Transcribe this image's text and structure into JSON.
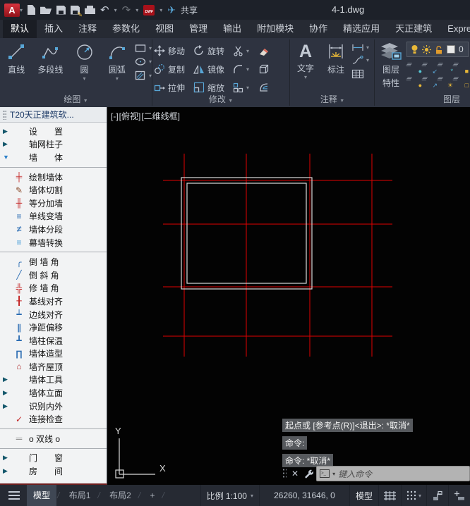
{
  "titlebar": {
    "app_initial": "A",
    "doc_title": "4-1.dwg",
    "dwf_label": "DWF",
    "share_label": "共享"
  },
  "ribbon_tabs": [
    {
      "label": "默认",
      "cls": "active"
    },
    {
      "label": "插入"
    },
    {
      "label": "注释"
    },
    {
      "label": "参数化"
    },
    {
      "label": "视图"
    },
    {
      "label": "管理"
    },
    {
      "label": "输出"
    },
    {
      "label": "附加模块"
    },
    {
      "label": "协作"
    },
    {
      "label": "精选应用"
    },
    {
      "label": "天正建筑"
    },
    {
      "label": "Express Tools"
    }
  ],
  "ribbon": {
    "draw": {
      "label": "绘图",
      "line": "直线",
      "polyline": "多段线",
      "circle": "圆",
      "arc": "圆弧"
    },
    "modify": {
      "label": "修改",
      "move": "移动",
      "rotate": "旋转",
      "copy": "复制",
      "mirror": "镜像",
      "stretch": "拉伸",
      "scale": "缩放"
    },
    "annotate": {
      "label": "注释",
      "text": "文字",
      "dimension": "标注"
    },
    "layers": {
      "label": "图层",
      "properties_line1": "图层",
      "properties_line2": "特性",
      "current_layer": "0"
    }
  },
  "layer_tools": [
    {
      "e": "●",
      "c": "#57c7d4"
    },
    {
      "e": "↙",
      "c": "#58a6d6"
    },
    {
      "e": "*",
      "c": "#57c7d4"
    },
    {
      "e": "■",
      "c": "#e8b838"
    },
    {
      "e": "●",
      "c": "#e8b838"
    },
    {
      "e": "↗",
      "c": "#58a6d6"
    },
    {
      "e": "☀",
      "c": "#e8b838"
    },
    {
      "e": "□",
      "c": "#e8b838"
    }
  ],
  "palette": {
    "title": "T20天正建筑软...",
    "items": [
      {
        "arrow": "▶",
        "ac": "#14576b",
        "label": "设　　置"
      },
      {
        "arrow": "▶",
        "ac": "#14576b",
        "label": "轴网柱子"
      },
      {
        "arrow": "▼",
        "ac": "#2f81c9",
        "label": "墙　　体"
      },
      {
        "cls": "sep"
      },
      {
        "glyph": "╪",
        "gc": "#c32222",
        "label": "绘制墙体"
      },
      {
        "glyph": "✎",
        "gc": "#8a4a2a",
        "label": "墙体切割"
      },
      {
        "glyph": "╫",
        "gc": "#c32222",
        "label": "等分加墙"
      },
      {
        "glyph": "≡",
        "gc": "#2f6fb4",
        "label": "单线变墙"
      },
      {
        "glyph": "≠",
        "gc": "#2f6fb4",
        "label": "墙体分段"
      },
      {
        "glyph": "≡",
        "gc": "#4a9fd8",
        "label": "幕墙转换"
      },
      {
        "cls": "sep"
      },
      {
        "glyph": "╭",
        "gc": "#2f6fb4",
        "label": "倒 墙 角"
      },
      {
        "glyph": "╱",
        "gc": "#2f6fb4",
        "label": "倒 斜 角"
      },
      {
        "glyph": "╬",
        "gc": "#c32222",
        "label": "修 墙 角"
      },
      {
        "glyph": "╂",
        "gc": "#c32222",
        "label": "基线对齐"
      },
      {
        "glyph": "┷",
        "gc": "#2f6fb4",
        "label": "边线对齐"
      },
      {
        "glyph": "∥",
        "gc": "#2f6fb4",
        "label": "净距偏移"
      },
      {
        "glyph": "┻",
        "gc": "#2f6fb4",
        "label": "墙柱保温"
      },
      {
        "glyph": "∏",
        "gc": "#2f6fb4",
        "label": "墙体造型"
      },
      {
        "glyph": "⌂",
        "gc": "#b03030",
        "label": "墙齐屋顶"
      },
      {
        "arrow": "▶",
        "ac": "#14576b",
        "label": "墙体工具"
      },
      {
        "arrow": "▶",
        "ac": "#14576b",
        "label": "墙体立面"
      },
      {
        "arrow": "▶",
        "ac": "#14576b",
        "label": "识别内外"
      },
      {
        "glyph": "✓",
        "gc": "#c32222",
        "label": "连接检查"
      },
      {
        "cls": "sep"
      },
      {
        "glyph": "═",
        "gc": "#8a8a8a",
        "label": "o 双线 o"
      },
      {
        "cls": "sep"
      },
      {
        "arrow": "▶",
        "ac": "#14576b",
        "label": "门　　窗"
      },
      {
        "arrow": "▶",
        "ac": "#14576b",
        "label": "房　　间"
      }
    ]
  },
  "viewport": {
    "menu": "[-]",
    "view": "[俯视]",
    "style": "[二维线框]",
    "ucs_x": "X",
    "ucs_y": "Y"
  },
  "command": {
    "history": [
      {
        "text": "起点或 [参考点(R)]<退出>: *取消*"
      },
      {
        "text": "命令:"
      },
      {
        "text": "命令: *取消*"
      }
    ],
    "placeholder": "键入命令"
  },
  "statusbar": {
    "tabs": [
      {
        "label": "模型",
        "cls": "active"
      },
      {
        "label": "布局1"
      },
      {
        "label": "布局2"
      },
      {
        "label": "+"
      }
    ],
    "scale": "比例 1:100",
    "coords": "26260, 31646, 0",
    "model_toggle": "模型"
  },
  "colors": {
    "axis_red": "#e00000",
    "wall_line": "#d9d9d9",
    "accent_blue": "#58a6d6",
    "accent_yellow": "#e8b838"
  }
}
